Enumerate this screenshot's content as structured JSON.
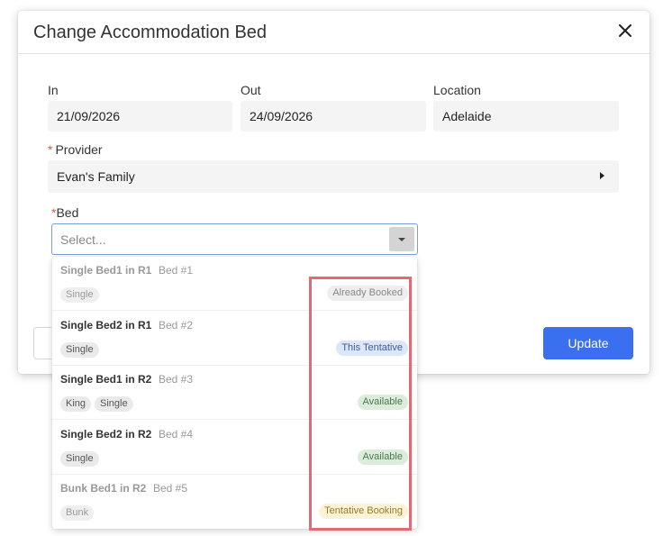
{
  "modal": {
    "title": "Change Accommodation Bed",
    "update_label": "Update"
  },
  "fields": {
    "in": {
      "label": "In",
      "value": "21/09/2026"
    },
    "out": {
      "label": "Out",
      "value": "24/09/2026"
    },
    "location": {
      "label": "Location",
      "value": "Adelaide"
    },
    "provider": {
      "required_mark": "*",
      "label": "Provider",
      "value": "Evan's Family"
    },
    "bed": {
      "required_mark": "*",
      "label": "Bed",
      "placeholder": "Select..."
    }
  },
  "bed_options": [
    {
      "name": "Single Bed1 in R1",
      "bed_no": "Bed #1",
      "tags": [
        "Single"
      ],
      "status": "Already Booked",
      "status_bg": "#eeeeee",
      "status_fg": "#888888",
      "disabled": true
    },
    {
      "name": "Single Bed2 in R1",
      "bed_no": "Bed #2",
      "tags": [
        "Single"
      ],
      "status": "This Tentative",
      "status_bg": "#dbe6f8",
      "status_fg": "#3d5d9c",
      "disabled": false
    },
    {
      "name": "Single Bed1 in R2",
      "bed_no": "Bed #3",
      "tags": [
        "King",
        "Single"
      ],
      "status": "Available",
      "status_bg": "#dcecdc",
      "status_fg": "#4a7a4a",
      "disabled": false
    },
    {
      "name": "Single Bed2 in R2",
      "bed_no": "Bed #4",
      "tags": [
        "Single"
      ],
      "status": "Available",
      "status_bg": "#dcecdc",
      "status_fg": "#4a7a4a",
      "disabled": false
    },
    {
      "name": "Bunk Bed1 in R2",
      "bed_no": "Bed #5",
      "tags": [
        "Bunk"
      ],
      "status": "Tentative Booking",
      "status_bg": "#fbf3d6",
      "status_fg": "#9a7a2a",
      "disabled": true
    }
  ],
  "colors": {
    "accent": "#3a6ff0",
    "highlight_border": "#e06b73",
    "required": "#e5534b"
  }
}
